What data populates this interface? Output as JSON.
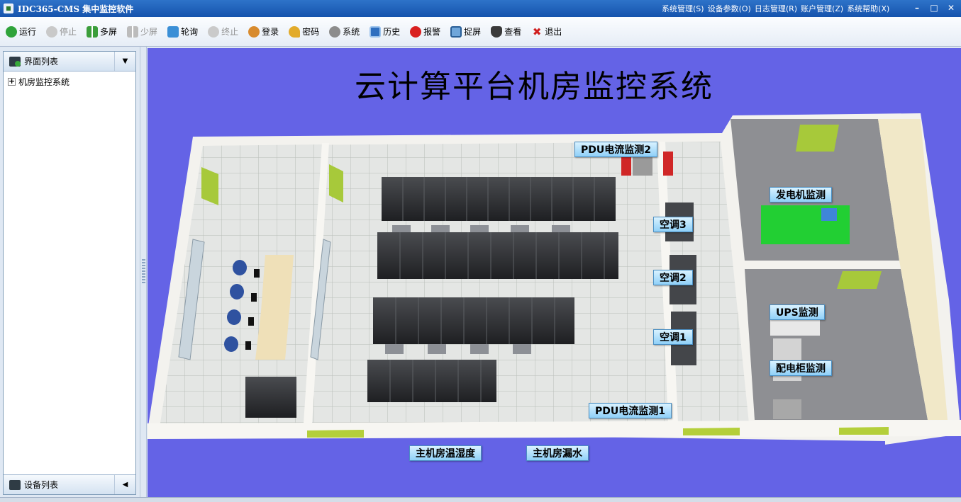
{
  "window": {
    "title": "IDC365-CMS 集中监控软件",
    "menus": [
      "系统管理(S)",
      "设备参数(O)",
      "日志管理(R)",
      "账户管理(Z)",
      "系统帮助(X)"
    ]
  },
  "toolbar": {
    "items": [
      {
        "label": "运行",
        "icon": "run-icon",
        "enabled": true
      },
      {
        "label": "停止",
        "icon": "stop-icon",
        "enabled": false
      },
      {
        "label": "多屏",
        "icon": "multi-screen-icon",
        "enabled": true
      },
      {
        "label": "少屏",
        "icon": "few-screen-icon",
        "enabled": false
      },
      {
        "label": "轮询",
        "icon": "poll-icon",
        "enabled": true
      },
      {
        "label": "终止",
        "icon": "terminate-icon",
        "enabled": false
      },
      {
        "label": "登录",
        "icon": "login-icon",
        "enabled": true
      },
      {
        "label": "密码",
        "icon": "key-icon",
        "enabled": true
      },
      {
        "label": "系统",
        "icon": "gear-icon",
        "enabled": true
      },
      {
        "label": "历史",
        "icon": "history-icon",
        "enabled": true
      },
      {
        "label": "报警",
        "icon": "alarm-icon",
        "enabled": true
      },
      {
        "label": "捉屏",
        "icon": "screenshot-icon",
        "enabled": true
      },
      {
        "label": "查看",
        "icon": "binoculars-icon",
        "enabled": true
      },
      {
        "label": "退出",
        "icon": "exit-icon",
        "enabled": true
      }
    ]
  },
  "sidebar": {
    "header": "界面列表",
    "tree": [
      {
        "label": "机房监控系统",
        "expanded": false
      }
    ],
    "footer": "设备列表"
  },
  "stage": {
    "title": "云计算平台机房监控系统",
    "labels": {
      "pdu2": "PDU电流监测2",
      "ac3": "空调3",
      "ac2": "空调2",
      "ac1": "空调1",
      "pdu1": "PDU电流监测1",
      "generator": "发电机监测",
      "ups": "UPS监测",
      "dist": "配电柜监测",
      "temp": "主机房温湿度",
      "leak": "主机房漏水"
    }
  },
  "colors": {
    "stage_bg": "#6463e6",
    "titlebar": "#1f63bd",
    "label_bg": "#9dd6fa"
  }
}
